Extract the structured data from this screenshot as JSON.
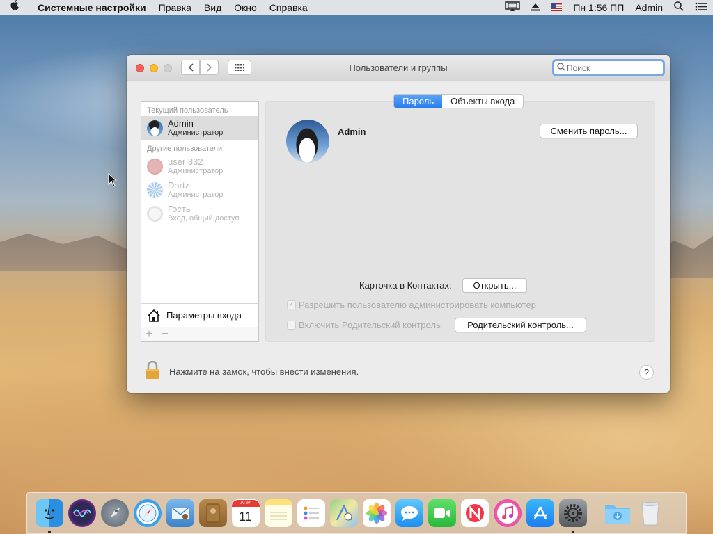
{
  "menubar": {
    "app_name": "Системные настройки",
    "menus": [
      "Правка",
      "Вид",
      "Окно",
      "Справка"
    ],
    "clock": "Пн 1:56 ПП",
    "user": "Admin"
  },
  "window": {
    "title": "Пользователи и группы",
    "search_placeholder": "Поиск"
  },
  "sidebar": {
    "current_header": "Текущий пользователь",
    "current": {
      "name": "Admin",
      "role": "Администратор"
    },
    "others_header": "Другие пользователи",
    "others": [
      {
        "name": "user 832",
        "role": "Администратор"
      },
      {
        "name": "Dartz",
        "role": "Администратор"
      },
      {
        "name": "Гость",
        "role": "Вход, общий доступ"
      }
    ],
    "login_options": "Параметры входа",
    "add": "+",
    "remove": "−"
  },
  "tabs": [
    "Пароль",
    "Объекты входа"
  ],
  "active_tab": "Пароль",
  "main": {
    "user_name": "Admin",
    "change_password": "Сменить пароль...",
    "contacts_label": "Карточка в Контактах:",
    "open_button": "Открыть...",
    "allow_admin": "Разрешить пользователю администрировать компьютер",
    "allow_admin_checked": true,
    "parental_label": "Включить Родительский контроль",
    "parental_checked": false,
    "parental_button": "Родительский контроль..."
  },
  "footer": {
    "lock_text": "Нажмите на замок, чтобы внести изменения.",
    "help": "?"
  },
  "dock": {
    "items": [
      "finder",
      "siri",
      "launchpad",
      "safari",
      "mail",
      "notes-book",
      "calendar",
      "notes",
      "reminders",
      "maps",
      "photos",
      "messages",
      "facetime",
      "news",
      "itunes",
      "app-store",
      "system-preferences",
      "downloads",
      "trash"
    ],
    "calendar_month": "АПР",
    "calendar_day": "11"
  }
}
